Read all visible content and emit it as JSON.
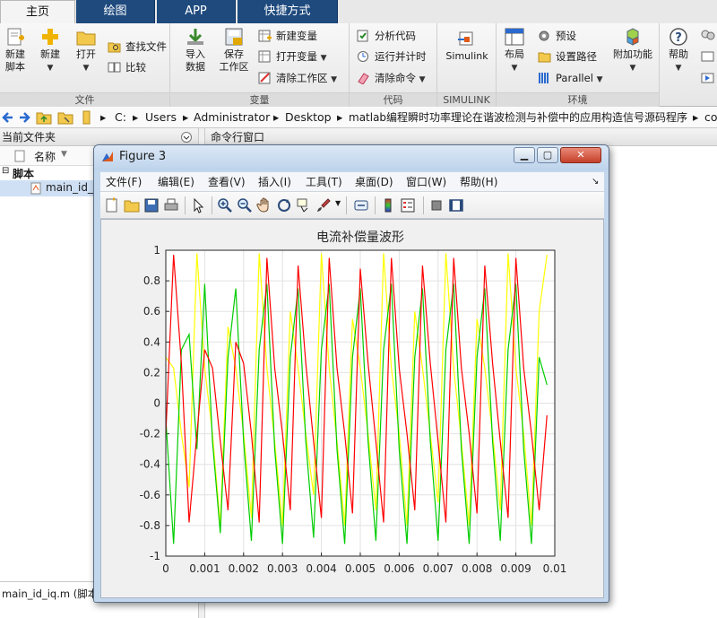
{
  "tabs": [
    "主页",
    "绘图",
    "APP",
    "快捷方式"
  ],
  "ribbon": {
    "file": {
      "label": "文件",
      "new_script": [
        "新建",
        "脚本"
      ],
      "new": "新建",
      "open": "打开",
      "find_files": "查找文件",
      "compare": "比较"
    },
    "variable": {
      "label": "变量",
      "import": [
        "导入",
        "数据"
      ],
      "save_ws": [
        "保存",
        "工作区"
      ],
      "new_var": "新建变量",
      "open_var": "打开变量",
      "clear_ws": "清除工作区"
    },
    "code": {
      "label": "代码",
      "analyze": "分析代码",
      "run_time": "运行并计时",
      "clear_cmd": "清除命令"
    },
    "simulink": {
      "label": "SIMULINK",
      "btn": "Simulink"
    },
    "env": {
      "label": "环境",
      "layout": "布局",
      "prefs": "预设",
      "set_path": "设置路径",
      "parallel": "Parallel",
      "addons": "附加功能"
    },
    "help": {
      "label": "帮助"
    }
  },
  "address": {
    "drive": "C:",
    "parts": [
      "Users",
      "Administrator",
      "Desktop",
      "matlab编程瞬时功率理论在谐波检测与补偿中的应用构造信号源码程序",
      "co"
    ]
  },
  "left_panel": {
    "title": "当前文件夹",
    "col_name": "名称",
    "group": "脚本",
    "file": "main_id_iq.m",
    "footer": "main_id_iq.m  (脚本)"
  },
  "cmd_panel": {
    "title": "命令行窗口"
  },
  "figure": {
    "title": "Figure 3",
    "menu": [
      "文件(F)",
      "编辑(E)",
      "查看(V)",
      "插入(I)",
      "工具(T)",
      "桌面(D)",
      "窗口(W)",
      "帮助(H)"
    ],
    "toolbar_icons": [
      "new-figure-icon",
      "open-file-icon",
      "save-icon",
      "print-icon",
      "pointer-icon",
      "zoom-in-icon",
      "zoom-out-icon",
      "pan-icon",
      "rotate-icon",
      "data-cursor-icon",
      "brush-icon",
      "link-icon",
      "colorbar-icon",
      "legend-icon",
      "hide-plot-tools-icon",
      "show-plot-tools-icon"
    ]
  },
  "chart_data": {
    "type": "line",
    "title": "电流补偿量波形",
    "xlabel": "",
    "ylabel": "",
    "xlim": [
      0,
      0.01
    ],
    "ylim": [
      -1,
      1
    ],
    "xticks": [
      "0",
      "0.001",
      "0.002",
      "0.003",
      "0.004",
      "0.005",
      "0.006",
      "0.007",
      "0.008",
      "0.009",
      "0.01"
    ],
    "yticks": [
      "1",
      "0.8",
      "0.6",
      "0.4",
      "0.2",
      "0",
      "-0.2",
      "-0.4",
      "-0.6",
      "-0.8",
      "-1"
    ],
    "grid": true,
    "colors": {
      "series_a": "#ffff00",
      "series_b": "#00cc00",
      "series_c": "#ff0000"
    },
    "series": [
      {
        "color": "#ffff00",
        "x": [
          0,
          0.0002,
          0.0004,
          0.0006,
          0.0008,
          0.001,
          0.0012,
          0.0014,
          0.0016,
          0.0018,
          0.002,
          0.0022,
          0.0024,
          0.0026,
          0.0028,
          0.003,
          0.0032,
          0.0034,
          0.0036,
          0.0038,
          0.004,
          0.0042,
          0.0044,
          0.0046,
          0.0048,
          0.005,
          0.0052,
          0.0054,
          0.0056,
          0.0058,
          0.006,
          0.0062,
          0.0064,
          0.0066,
          0.0068,
          0.007,
          0.0072,
          0.0074,
          0.0076,
          0.0078,
          0.008,
          0.0082,
          0.0084,
          0.0086,
          0.0088,
          0.009,
          0.0092,
          0.0094,
          0.0096,
          0.0098
        ],
        "y": [
          0.3,
          0.23,
          -0.2,
          -0.55,
          0.98,
          0.23,
          -0.2,
          -0.8,
          0.5,
          0.23,
          -0.2,
          -0.75,
          0.98,
          0.23,
          -0.25,
          -0.8,
          0.6,
          0.23,
          -0.2,
          -0.6,
          0.98,
          0.23,
          -0.25,
          -0.8,
          0.55,
          0.23,
          -0.2,
          -0.7,
          0.98,
          0.23,
          -0.2,
          -0.8,
          0.6,
          0.23,
          -0.2,
          -0.65,
          0.98,
          0.23,
          -0.25,
          -0.8,
          0.55,
          0.23,
          -0.2,
          -0.7,
          0.98,
          0.23,
          -0.2,
          -0.8,
          0.6,
          0.97
        ]
      },
      {
        "color": "#00cc00",
        "x": [
          0,
          0.0002,
          0.0004,
          0.0006,
          0.0008,
          0.001,
          0.0012,
          0.0014,
          0.0016,
          0.0018,
          0.002,
          0.0022,
          0.0024,
          0.0026,
          0.0028,
          0.003,
          0.0032,
          0.0034,
          0.0036,
          0.0038,
          0.004,
          0.0042,
          0.0044,
          0.0046,
          0.0048,
          0.005,
          0.0052,
          0.0054,
          0.0056,
          0.0058,
          0.006,
          0.0062,
          0.0064,
          0.0066,
          0.0068,
          0.007,
          0.0072,
          0.0074,
          0.0076,
          0.0078,
          0.008,
          0.0082,
          0.0084,
          0.0086,
          0.0088,
          0.009,
          0.0092,
          0.0094,
          0.0096,
          0.0098
        ],
        "y": [
          -0.1,
          -0.92,
          0.35,
          0.45,
          -0.3,
          0.78,
          -0.25,
          -0.85,
          0.3,
          0.75,
          -0.25,
          -0.9,
          0.35,
          0.78,
          -0.3,
          -0.92,
          0.3,
          0.75,
          -0.25,
          -0.88,
          0.35,
          0.78,
          -0.3,
          -0.92,
          0.3,
          0.75,
          -0.25,
          -0.9,
          0.35,
          0.78,
          -0.3,
          -0.92,
          0.3,
          0.75,
          -0.25,
          -0.9,
          0.35,
          0.78,
          -0.3,
          -0.92,
          0.3,
          0.75,
          -0.25,
          -0.9,
          0.35,
          0.78,
          -0.3,
          -0.92,
          0.3,
          0.12
        ]
      },
      {
        "color": "#ff0000",
        "x": [
          0,
          0.0002,
          0.0004,
          0.0006,
          0.0008,
          0.001,
          0.0012,
          0.0014,
          0.0016,
          0.0018,
          0.002,
          0.0022,
          0.0024,
          0.0026,
          0.0028,
          0.003,
          0.0032,
          0.0034,
          0.0036,
          0.0038,
          0.004,
          0.0042,
          0.0044,
          0.0046,
          0.0048,
          0.005,
          0.0052,
          0.0054,
          0.0056,
          0.0058,
          0.006,
          0.0062,
          0.0064,
          0.0066,
          0.0068,
          0.007,
          0.0072,
          0.0074,
          0.0076,
          0.0078,
          0.008,
          0.0082,
          0.0084,
          0.0086,
          0.0088,
          0.009,
          0.0092,
          0.0094,
          0.0096,
          0.0098
        ],
        "y": [
          -0.2,
          0.97,
          0.26,
          -0.78,
          -0.2,
          0.35,
          0.23,
          -0.25,
          -0.7,
          0.4,
          0.26,
          -0.2,
          -0.78,
          0.95,
          0.23,
          -0.2,
          -0.7,
          0.9,
          0.26,
          -0.25,
          -0.75,
          0.95,
          0.23,
          -0.2,
          -0.72,
          0.88,
          0.26,
          -0.25,
          -0.78,
          0.95,
          0.23,
          -0.2,
          -0.7,
          0.9,
          0.26,
          -0.25,
          -0.78,
          0.95,
          0.23,
          -0.2,
          -0.72,
          0.9,
          0.26,
          -0.25,
          -0.75,
          0.95,
          0.23,
          -0.2,
          -0.7,
          -0.08
        ]
      }
    ]
  }
}
